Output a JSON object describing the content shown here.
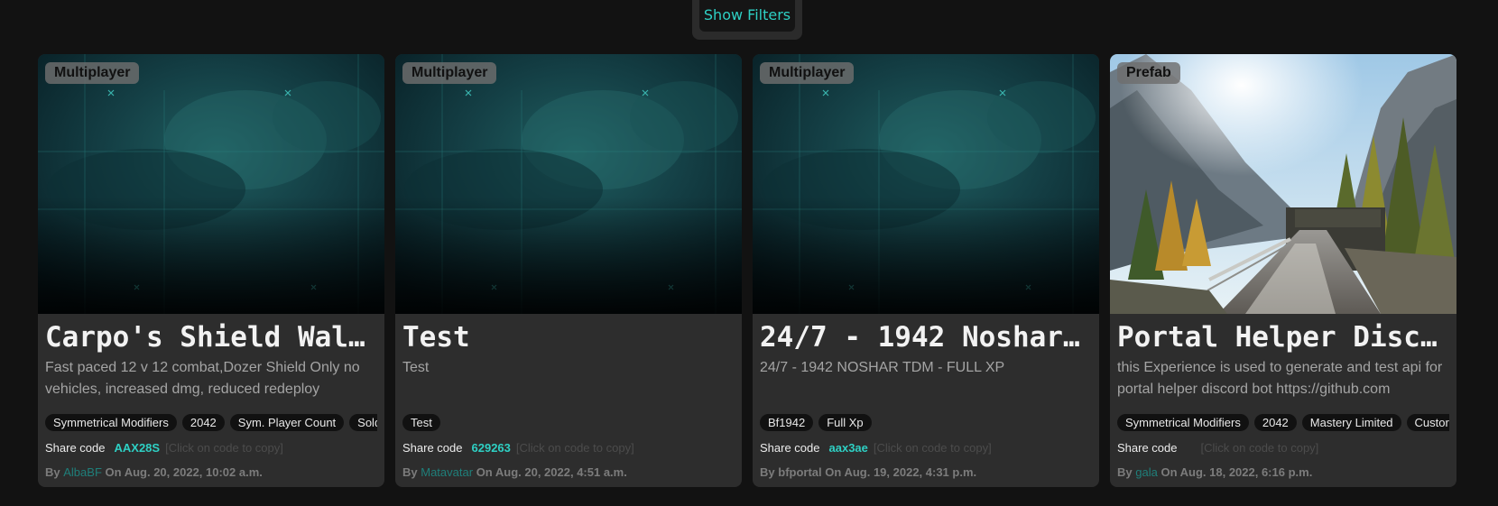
{
  "toolbar": {
    "filters_label": "Show Filters"
  },
  "colors": {
    "background": "#121212",
    "card": "#2d2d2d",
    "accent": "#2ed0c4",
    "tag_bg": "#111111"
  },
  "cards": [
    {
      "badge": "Multiplayer",
      "image": "teal-grid-image",
      "title": "Carpo's Shield Wall…",
      "description": "Fast paced 12 v 12 combat,Dozer Shield Only no vehicles, increased dmg, reduced redeploy",
      "tags": [
        "Symmetrical Modifiers",
        "2042",
        "Sym. Player Count",
        "Sold"
      ],
      "share_label": "Share code",
      "share_code": "AAX28S",
      "share_hint": "[Click on code to copy]",
      "by_label": "By",
      "author": "AlbaBF",
      "date": "On Aug. 20, 2022, 10:02 a.m."
    },
    {
      "badge": "Multiplayer",
      "image": "teal-grid-image",
      "title": "Test",
      "description": "Test",
      "tags": [
        "Test"
      ],
      "share_label": "Share code",
      "share_code": "629263",
      "share_hint": "[Click on code to copy]",
      "by_label": "By",
      "author": "Matavatar",
      "date": "On Aug. 20, 2022, 4:51 a.m."
    },
    {
      "badge": "Multiplayer",
      "image": "teal-grid-image",
      "title": "24/7 - 1942 Noshar …",
      "description": "24/7 - 1942 NOSHAR TDM - FULL XP",
      "tags": [
        "Bf1942",
        "Full Xp"
      ],
      "share_label": "Share code",
      "share_code": "aax3ae",
      "share_hint": "[Click on code to copy]",
      "by_label": "By",
      "author": "bfportal",
      "date": "On Aug. 19, 2022, 4:31 p.m."
    },
    {
      "badge": "Prefab",
      "image": "mountain-road-photo",
      "title": "Portal Helper Disco…",
      "description": "this Experience is used to generate and test api for portal helper discord bot https://github.com",
      "tags": [
        "Symmetrical Modifiers",
        "2042",
        "Mastery Limited",
        "Custor"
      ],
      "share_label": "Share code",
      "share_code": "",
      "share_hint": "[Click on code to copy]",
      "by_label": "By",
      "author": "gala",
      "date": "On Aug. 18, 2022, 6:16 p.m."
    }
  ]
}
